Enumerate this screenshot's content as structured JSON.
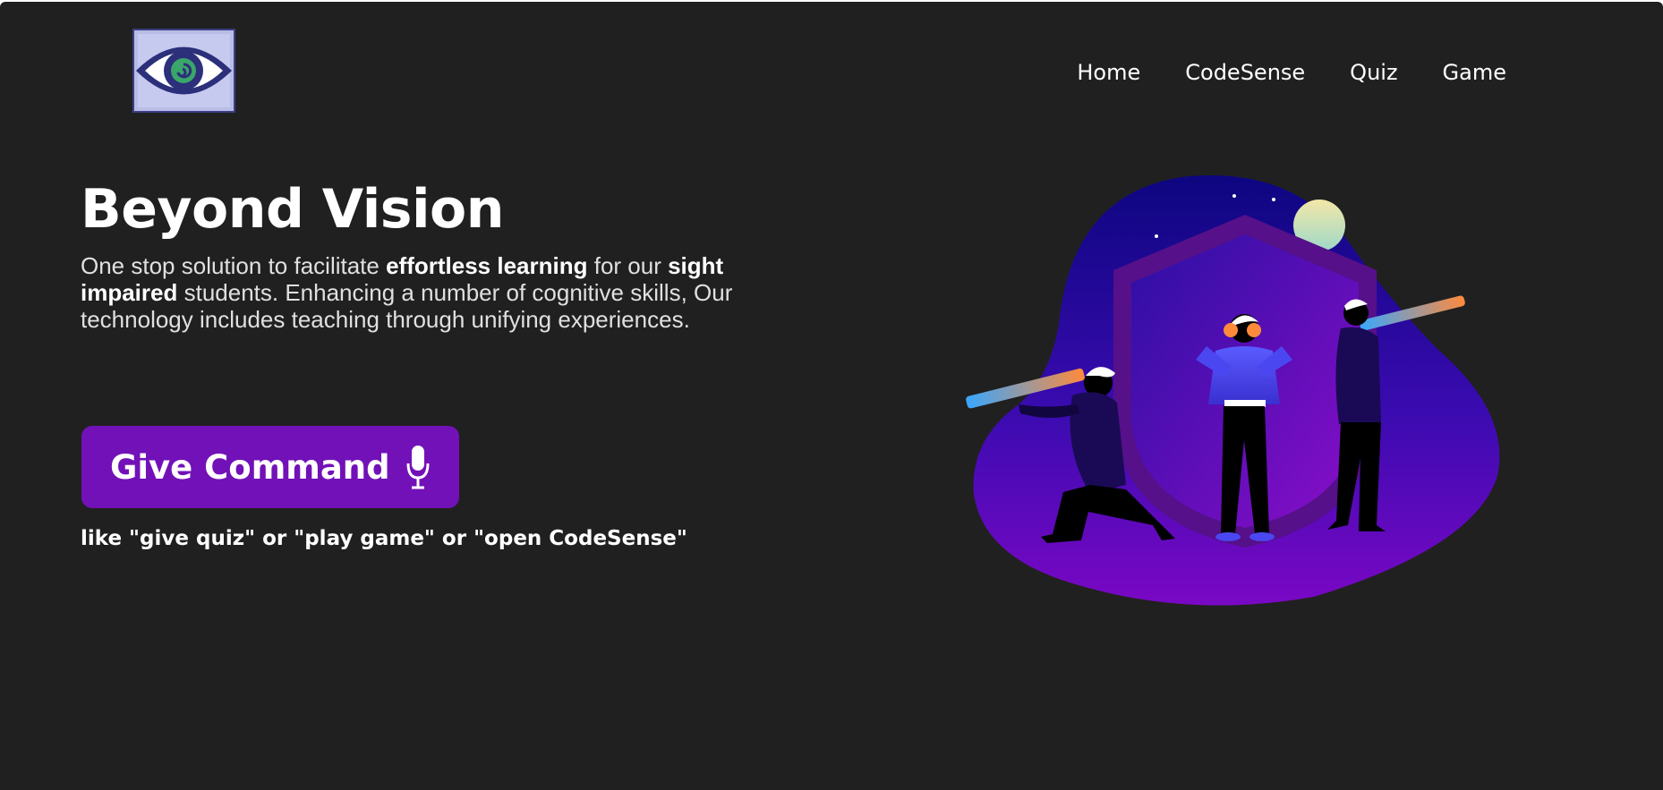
{
  "nav": {
    "items": [
      {
        "label": "Home"
      },
      {
        "label": "CodeSense"
      },
      {
        "label": "Quiz"
      },
      {
        "label": "Game"
      }
    ]
  },
  "hero": {
    "title": "Beyond Vision",
    "desc": {
      "p1": "One stop solution to facilitate ",
      "b1": "effortless learning",
      "p2": " for our ",
      "b2": "sight impaired",
      "p3": " students. Enhancing a number of cognitive skills, Our technology includes teaching through unifying experiences."
    },
    "button_label": "Give Command",
    "hint": "like \"give quiz\" or \"play game\" or \"open CodeSense\""
  },
  "icons": {
    "logo": "eye-logo-icon",
    "button": "microphone-icon",
    "illustration": "explorers-shield-illustration"
  },
  "colors": {
    "background": "#202020",
    "accent": "#7211b8",
    "text": "#ffffff"
  }
}
